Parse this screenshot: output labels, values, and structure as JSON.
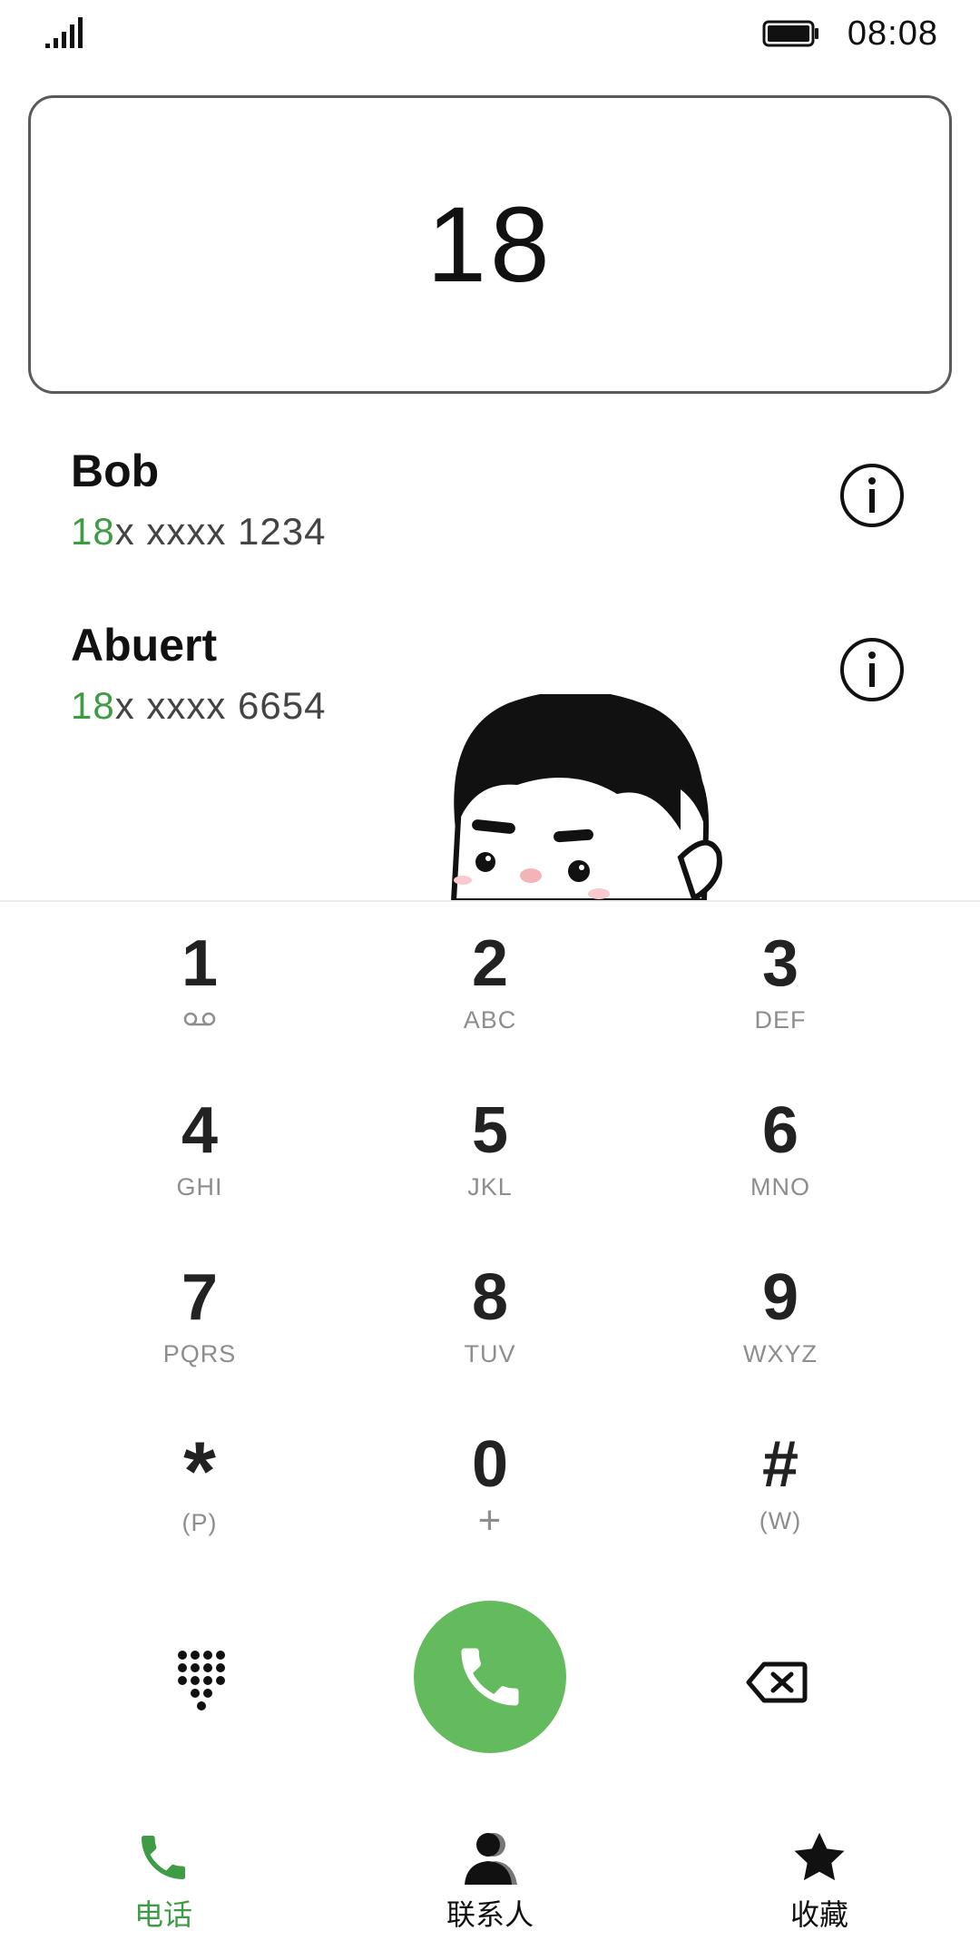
{
  "status_bar": {
    "time": "08:08",
    "signal_icon": "signal-bars-icon",
    "battery_icon": "battery-full-icon"
  },
  "dialer": {
    "number": "18"
  },
  "contacts": [
    {
      "name": "Bob",
      "number_match": "18",
      "number_rest": "x xxxx 1234",
      "info_icon": "info-icon"
    },
    {
      "name": "Abuert",
      "number_match": "18",
      "number_rest": "x xxxx 6654",
      "info_icon": "info-icon"
    }
  ],
  "keypad": [
    {
      "digit": "1",
      "letters": "",
      "icon": "voicemail-icon"
    },
    {
      "digit": "2",
      "letters": "ABC"
    },
    {
      "digit": "3",
      "letters": "DEF"
    },
    {
      "digit": "4",
      "letters": "GHI"
    },
    {
      "digit": "5",
      "letters": "JKL"
    },
    {
      "digit": "6",
      "letters": "MNO"
    },
    {
      "digit": "7",
      "letters": "PQRS"
    },
    {
      "digit": "8",
      "letters": "TUV"
    },
    {
      "digit": "9",
      "letters": "WXYZ"
    },
    {
      "digit": "*",
      "letters": "(P)"
    },
    {
      "digit": "0",
      "letters": "+"
    },
    {
      "digit": "#",
      "letters": "(W)"
    }
  ],
  "actions": {
    "dialpad_icon": "dialpad-icon",
    "call_icon": "phone-icon",
    "backspace_icon": "backspace-icon"
  },
  "tabs": [
    {
      "label": "电话",
      "icon": "phone-icon",
      "active": true
    },
    {
      "label": "联系人",
      "icon": "contacts-icon",
      "active": false
    },
    {
      "label": "收藏",
      "icon": "star-icon",
      "active": false
    }
  ],
  "colors": {
    "accent": "#3f9b45",
    "call_button": "#63bb5d"
  }
}
